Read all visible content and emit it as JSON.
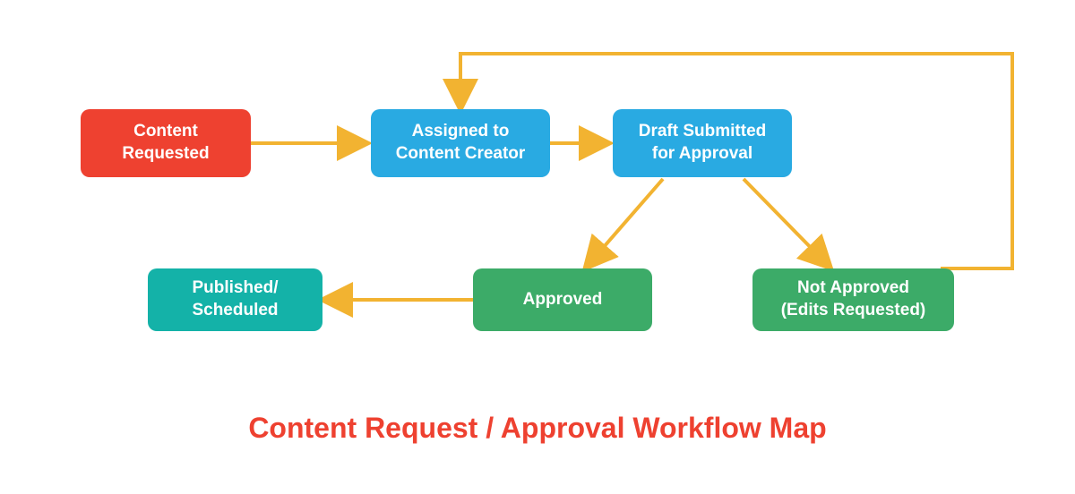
{
  "diagram": {
    "title": "Content Request / Approval Workflow Map",
    "nodes": {
      "requested": {
        "label": "Content\nRequested",
        "color": "#EE4130"
      },
      "assigned": {
        "label": "Assigned to\nContent Creator",
        "color": "#29AAE2"
      },
      "submitted": {
        "label": "Draft Submitted\nfor Approval",
        "color": "#29AAE2"
      },
      "approved": {
        "label": "Approved",
        "color": "#3CAB68"
      },
      "notapproved": {
        "label": "Not Approved\n(Edits Requested)",
        "color": "#3CAB68"
      },
      "published": {
        "label": "Published/\nScheduled",
        "color": "#14B2A8"
      }
    },
    "colors": {
      "arrow": "#F2B331",
      "title": "#EE4130"
    }
  }
}
